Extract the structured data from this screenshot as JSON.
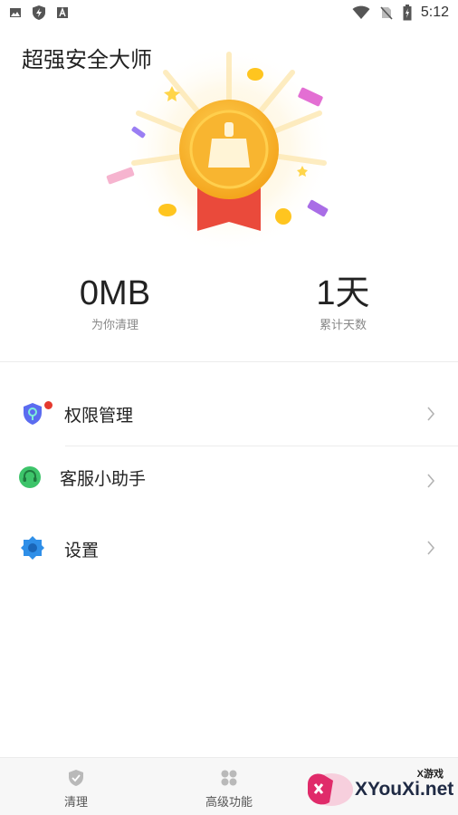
{
  "status_bar": {
    "time": "5:12",
    "icons": [
      "image-icon",
      "shield-notification-icon",
      "a-icon",
      "wifi-icon",
      "no-sim-icon",
      "battery-icon"
    ]
  },
  "app": {
    "title": "超强安全大师"
  },
  "stats": {
    "cleaned_value": "0MB",
    "cleaned_label": "为你清理",
    "days_value": "1天",
    "days_label": "累计天数"
  },
  "menu": {
    "items": [
      {
        "label": "权限管理",
        "icon": "shield-key-icon",
        "badge": true
      },
      {
        "label": "客服小助手",
        "icon": "headset-icon",
        "badge": false
      },
      {
        "label": "设置",
        "icon": "gear-icon",
        "badge": false
      }
    ]
  },
  "bottom_nav": {
    "items": [
      {
        "label": "清理",
        "icon": "shield-check-icon"
      },
      {
        "label": "高级功能",
        "icon": "grid-icon"
      }
    ]
  },
  "watermark": {
    "top": "X游戏",
    "main": "XYouXi.net"
  },
  "colors": {
    "medal_gold": "#f7b731",
    "ribbon_red": "#ea4a3b",
    "badge_red": "#e53a2f",
    "headset_green": "#3dc46a",
    "gear_blue": "#2f8fe8"
  }
}
